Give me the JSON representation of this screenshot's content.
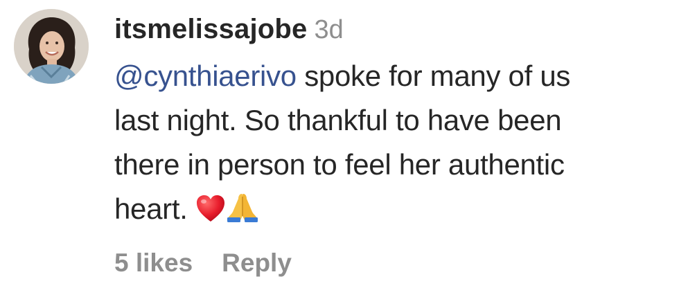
{
  "comment": {
    "username": "itsmelissajobe",
    "timestamp": "3d",
    "mention": "@cynthiaerivo",
    "text_line1_rest": " spoke for many of us",
    "text_line2": "last night. So thankful to have been",
    "text_line3": "there in person to feel her authentic",
    "text_line4": "heart. ",
    "emojis": [
      "red-heart-icon",
      "folded-hands-icon"
    ],
    "likes_label": "5 likes",
    "reply_label": "Reply"
  },
  "colors": {
    "text": "#262626",
    "muted": "#8e8e8e",
    "mention": "#37528f"
  }
}
